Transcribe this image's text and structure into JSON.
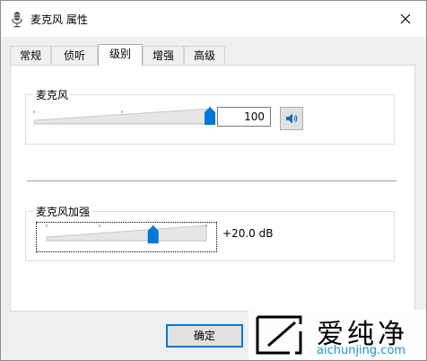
{
  "window": {
    "title": "麦克风 属性",
    "close_icon": "close-icon"
  },
  "tabs": [
    {
      "label": "常规",
      "active": false
    },
    {
      "label": "侦听",
      "active": false
    },
    {
      "label": "级别",
      "active": true
    },
    {
      "label": "增强",
      "active": false
    },
    {
      "label": "高级",
      "active": false
    }
  ],
  "microphone": {
    "label": "麦克风",
    "value": "100",
    "level_fraction": 1.0,
    "mute_icon": "speaker-icon"
  },
  "boost": {
    "label": "麦克风加强",
    "value": "+20.0 dB",
    "level_fraction": 0.667
  },
  "buttons": {
    "ok": "确定"
  },
  "watermark": {
    "brand": "爱纯净",
    "url": "aichunjing.com"
  },
  "colors": {
    "accent": "#0078d7",
    "watermark_blue": "#1f95d6"
  }
}
